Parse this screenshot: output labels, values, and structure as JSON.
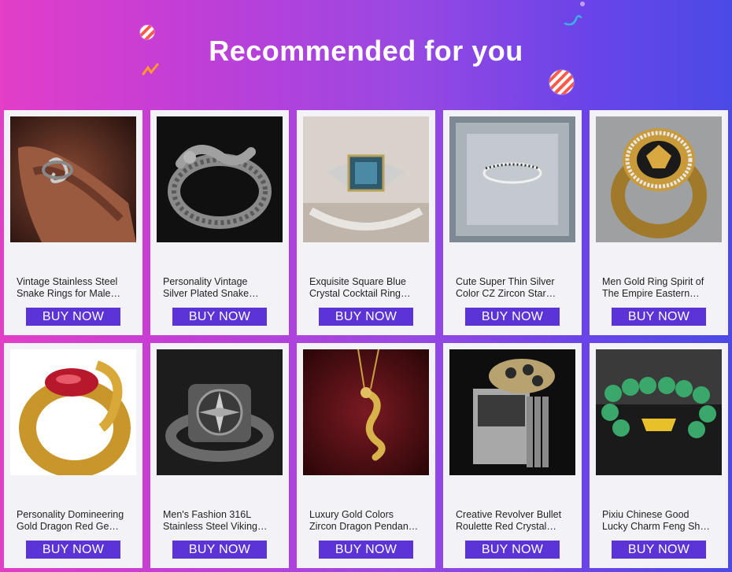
{
  "banner": {
    "title": "Recommended for you",
    "gradient_start": "#e23ec8",
    "gradient_end": "#4b4ae6",
    "button_color": "#5c33d6"
  },
  "products": [
    {
      "name": "Vintage Stainless Steel\nSnake Rings for Male…",
      "button": "BUY NOW",
      "image": "hand-snake-ring"
    },
    {
      "name": "Personality Vintage\nSilver Plated Snake…",
      "button": "BUY NOW",
      "image": "silver-snake-ring"
    },
    {
      "name": "Exquisite Square Blue\nCrystal Cocktail Ring…",
      "button": "BUY NOW",
      "image": "blue-crystal-ring"
    },
    {
      "name": "Cute Super Thin Silver\nColor CZ Zircon Star…",
      "button": "BUY NOW",
      "image": "thin-silver-ring"
    },
    {
      "name": "Men Gold Ring Spirit of\nThe Empire Eastern…",
      "button": "BUY NOW",
      "image": "gold-eagle-ring"
    },
    {
      "name": "Personality Domineering\nGold Dragon Red Ge…",
      "button": "BUY NOW",
      "image": "gold-dragon-ring"
    },
    {
      "name": "Men's Fashion 316L\nStainless Steel Viking…",
      "button": "BUY NOW",
      "image": "viking-compass-ring"
    },
    {
      "name": "Luxury Gold Colors\nZircon Dragon Pendan…",
      "button": "BUY NOW",
      "image": "dragon-pendant"
    },
    {
      "name": "Creative Revolver Bullet\nRoulette Red Crystal…",
      "button": "BUY NOW",
      "image": "revolver-ring"
    },
    {
      "name": "Pixiu Chinese Good\nLucky Charm Feng Sh…",
      "button": "BUY NOW",
      "image": "jade-bracelet"
    }
  ]
}
